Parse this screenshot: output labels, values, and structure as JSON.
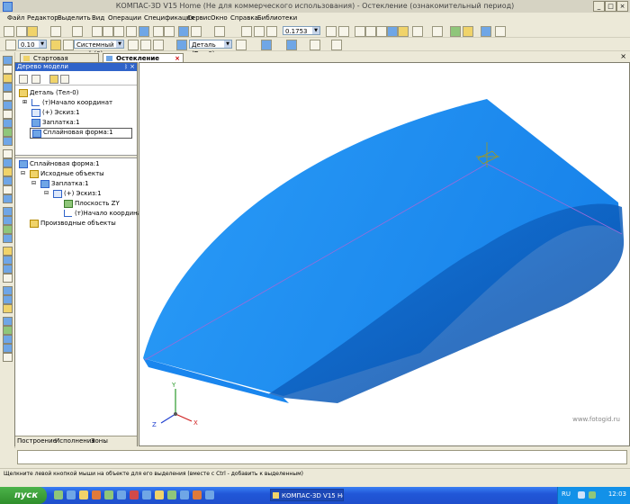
{
  "window": {
    "title": "КОМПАС-3D V15 Home (Не для коммерческого использования) - Остекление (ознакомительный период)"
  },
  "menu": [
    "Файл",
    "Редактор",
    "Выделить",
    "Вид",
    "Операции",
    "Спецификация",
    "Сервис",
    "Окно",
    "Справка",
    "Библиотеки"
  ],
  "toolbar": {
    "line_width": "0.10",
    "layer": "Системный слой (0)",
    "zoom": "0.1753",
    "detail": "Деталь (Тел-0)"
  },
  "tabs": [
    {
      "label": "Стартовая страница"
    },
    {
      "label": "Остекление"
    }
  ],
  "tree_panel": {
    "title": "Дерево модели",
    "pin": "📌",
    "top_items": [
      {
        "label": "Деталь (Тел-0)",
        "icon": "part-icon"
      },
      {
        "label": "(т)Начало координат",
        "icon": "origin-icon"
      },
      {
        "label": "(+) Эскиз:1",
        "icon": "sketch-icon"
      },
      {
        "label": "Заплатка:1",
        "icon": "patch-icon"
      },
      {
        "label": "Сплайновая форма:1",
        "icon": "spline-form-icon"
      }
    ],
    "bottom_items": [
      {
        "label": "Сплайновая форма:1"
      },
      {
        "label": "Исходные объекты"
      },
      {
        "label": "Заплатка:1"
      },
      {
        "label": "(+) Эскиз:1"
      },
      {
        "label": "Плоскость ZY"
      },
      {
        "label": "(т)Начало координат"
      },
      {
        "label": "Производные объекты"
      }
    ],
    "bottom_tabs": [
      "Построение",
      "Исполнения",
      "Зоны"
    ]
  },
  "axes": {
    "x": "X",
    "y": "Y",
    "z": "Z"
  },
  "status": {
    "hint": "Щелкните левой кнопкой мыши на объекте для его выделения (вместе с Ctrl - добавить к выделенным)"
  },
  "taskbar": {
    "start": "пуск",
    "item": "КОМПАС-3D V15 Ho...",
    "lang": "RU",
    "clock": "12:03"
  },
  "watermark": "www.fotogid.ru",
  "colors": {
    "model": "#1e90ff",
    "model_dark": "#0f5bbf",
    "accent": "#2f63c9"
  }
}
